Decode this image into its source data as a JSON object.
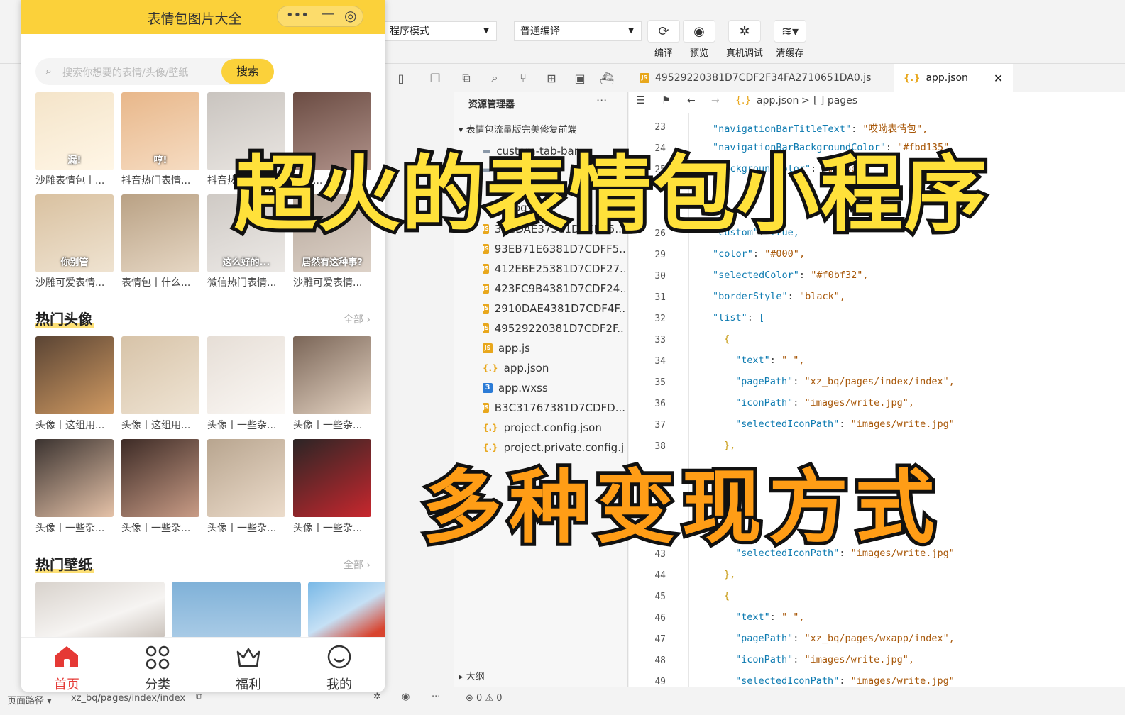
{
  "toolbar": {
    "mode_select": "程序模式",
    "compile_select": "普通编译",
    "buttons": [
      {
        "label": "编译",
        "icon": "refresh-icon"
      },
      {
        "label": "预览",
        "icon": "eye-icon"
      },
      {
        "label": "真机调试",
        "icon": "bug-icon"
      },
      {
        "label": "清缓存",
        "icon": "layers-icon"
      }
    ]
  },
  "editor_tabs": [
    {
      "label": "49529220381D7CDF2F34FA2710651DA0.js",
      "type": "js"
    },
    {
      "label": "app.json",
      "type": "json",
      "active": true
    }
  ],
  "breadcrumb": {
    "file": "app.json",
    "sep": ">",
    "node": "[ ] pages"
  },
  "explorer": {
    "title": "资源管理器",
    "more": "···",
    "project": "表情包流量版完美修复前端",
    "files": [
      {
        "name": "custom-tab-bar",
        "type": "folder"
      },
      {
        "name": "images",
        "type": "folder"
      },
      {
        "name": "xz_bq",
        "type": "folder"
      },
      {
        "name": "32CDAE37381D7CDF5...",
        "type": "js"
      },
      {
        "name": "93EB71E6381D7CDFF5...",
        "type": "js"
      },
      {
        "name": "412EBE25381D7CDF27...",
        "type": "js"
      },
      {
        "name": "423FC9B4381D7CDF24...",
        "type": "js"
      },
      {
        "name": "2910DAE4381D7CDF4F...",
        "type": "js"
      },
      {
        "name": "49529220381D7CDF2F...",
        "type": "js"
      },
      {
        "name": "app.js",
        "type": "js"
      },
      {
        "name": "app.json",
        "type": "json"
      },
      {
        "name": "app.wxss",
        "type": "wxss"
      },
      {
        "name": "B3C31767381D7CDFD...",
        "type": "js"
      },
      {
        "name": "project.config.json",
        "type": "json"
      },
      {
        "name": "project.private.config.json",
        "type": "json"
      }
    ],
    "outline": "大纲"
  },
  "code_lines": [
    {
      "n": "23",
      "text": "\"navigationBarTitleText\": \"哎呦表情包\","
    },
    {
      "n": "24",
      "text": "\"navigationBarBackgroundColor\": \"#fbd135\","
    },
    {
      "n": "25",
      "text": "\"backgroundColor\": \"#fbbd1\""
    },
    {
      "n": "26",
      "text": "\"custom\": true,"
    },
    {
      "n": "29",
      "text": "\"color\": \"#000\","
    },
    {
      "n": "30",
      "text": "\"selectedColor\": \"#f0bf32\","
    },
    {
      "n": "31",
      "text": "\"borderStyle\": \"black\","
    },
    {
      "n": "32",
      "text": "\"list\": ["
    },
    {
      "n": "33",
      "text": "{"
    },
    {
      "n": "34",
      "text": "\"text\": \" \","
    },
    {
      "n": "35",
      "text": "\"pagePath\": \"xz_bq/pages/index/index\","
    },
    {
      "n": "36",
      "text": "\"iconPath\": \"images/write.jpg\","
    },
    {
      "n": "37",
      "text": "\"selectedIconPath\": \"images/write.jpg\""
    },
    {
      "n": "38",
      "text": "},"
    },
    {
      "n": "43",
      "text": "\"selectedIconPath\": \"images/write.jpg\""
    },
    {
      "n": "44",
      "text": "},"
    },
    {
      "n": "45",
      "text": "{"
    },
    {
      "n": "46",
      "text": "\"text\": \" \","
    },
    {
      "n": "47",
      "text": "\"pagePath\": \"xz_bq/pages/wxapp/index\","
    },
    {
      "n": "48",
      "text": "\"iconPath\": \"images/write.jpg\","
    },
    {
      "n": "49",
      "text": "\"selectedIconPath\": \"images/write.jpg\""
    }
  ],
  "status": {
    "path_label": "页面路径",
    "path": "xz_bq/pages/index/index",
    "errors": "0",
    "warnings": "0"
  },
  "phone": {
    "title": "表情包图片大全",
    "search_placeholder": "搜索你想要的表情/头像/壁纸",
    "search_button": "搜索",
    "emoji_captions": [
      "沙雕表情包丨...",
      "抖音热门表情...",
      "抖音热...",
      "表情...",
      "沙雕可爱表情...",
      "表情包丨什么...",
      "微信热门表情...",
      "沙雕可爱表情..."
    ],
    "emoji_overlays": [
      "漏!",
      "哼!",
      "",
      "",
      "你别管",
      "",
      "这么好的...",
      "居然有这种事?"
    ],
    "sections": {
      "avatar": "热门头像",
      "wallpaper": "热门壁纸",
      "more": "全部 ›"
    },
    "avatar_captions": [
      "头像丨这组用...",
      "头像丨这组用...",
      "头像丨一些杂...",
      "头像丨一些杂...",
      "头像丨一些杂...",
      "头像丨一些杂...",
      "头像丨一些杂...",
      "头像丨一些杂..."
    ],
    "tabs": [
      "首页",
      "分类",
      "福利",
      "我的"
    ],
    "accent": "#fbd13a",
    "active_tab_color": "#e53935"
  },
  "overlay": {
    "headline": "超火的表情包小程序",
    "subline": "多种变现方式"
  }
}
